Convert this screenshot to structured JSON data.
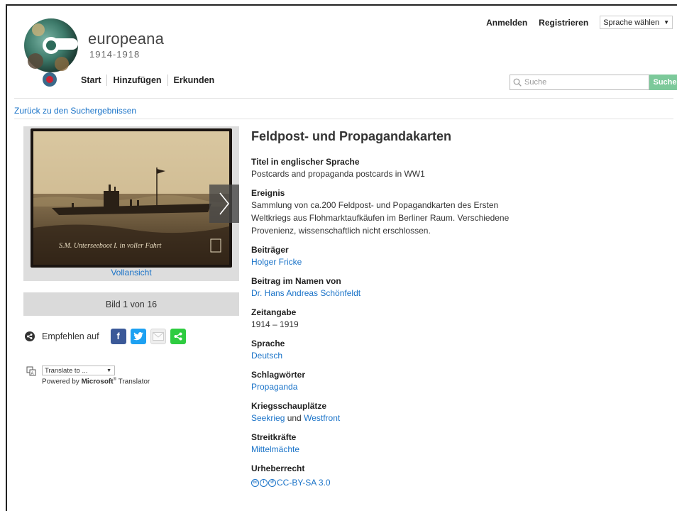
{
  "header": {
    "brand": "europeana",
    "years": "1914-1918",
    "nav": [
      "Start",
      "Hinzufügen",
      "Erkunden"
    ],
    "login": "Anmelden",
    "register": "Registrieren",
    "language_select": "Sprache wählen",
    "search_placeholder": "Suche",
    "search_button": "Suche"
  },
  "back_link": "Zurück zu den Suchergebnissen",
  "viewer": {
    "full_view": "Vollansicht",
    "pager": "Bild 1 von 16",
    "caption": "S.M. Unterseeboot I. in voller Fahrt"
  },
  "share": {
    "label": "Empfehlen auf",
    "icons": [
      "facebook-icon",
      "twitter-icon",
      "email-icon",
      "share-icon"
    ],
    "colors": {
      "facebook": "#3b5998",
      "twitter": "#1da1f2",
      "email": "#d9d9d9",
      "share": "#2ecc40"
    }
  },
  "translate": {
    "select": "Translate to ...",
    "powered_prefix": "Powered by ",
    "powered_brand": "Microsoft",
    "powered_suffix": " Translator"
  },
  "record": {
    "title": "Feldpost- und Propagandakarten",
    "fields": {
      "title_en_label": "Titel in englischer Sprache",
      "title_en": "Postcards and propaganda postcards in WW1",
      "event_label": "Ereignis",
      "event": "Sammlung von ca.200 Feldpost- und Popagandkarten des Ersten Weltkriegs aus Flohmarktaufkäufen im Berliner Raum. Verschiedene Provenienz, wissenschaftlich nicht erschlossen.",
      "contributor_label": "Beiträger",
      "contributor": "Holger Fricke",
      "on_behalf_label": "Beitrag im Namen von",
      "on_behalf": "Dr. Hans Andreas Schönfeldt",
      "date_label": "Zeitangabe",
      "date": "1914 – 1919",
      "language_label": "Sprache",
      "language": "Deutsch",
      "keywords_label": "Schlagwörter",
      "keywords": "Propaganda",
      "theatres_label": "Kriegsschauplätze",
      "theatre_1": "Seekrieg",
      "theatre_and": " und ",
      "theatre_2": "Westfront",
      "forces_label": "Streitkräfte",
      "forces": "Mittelmächte",
      "copyright_label": "Urheberrecht",
      "copyright": "CC-BY-SA 3.0"
    }
  },
  "colors": {
    "link": "#1a73c8",
    "search_button": "#7cc99a"
  }
}
